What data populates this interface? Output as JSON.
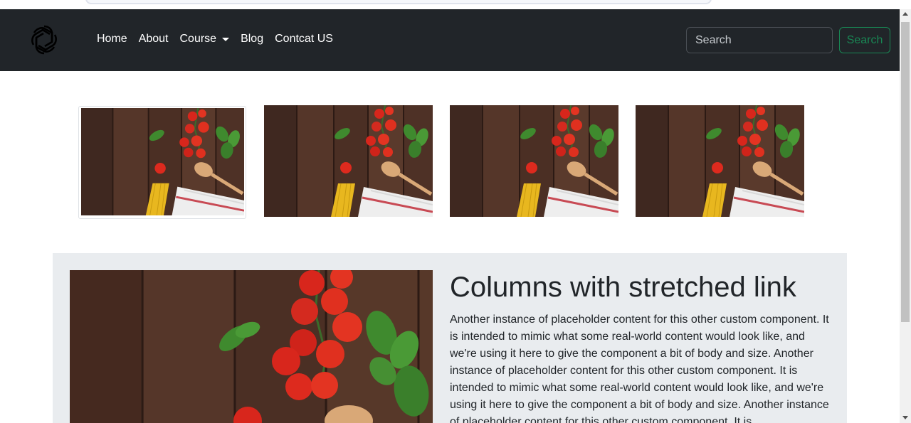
{
  "navbar": {
    "logo_icon": "openai-logo-icon",
    "links": [
      {
        "label": "Home"
      },
      {
        "label": "About"
      },
      {
        "label": "Course"
      },
      {
        "label": "Blog"
      },
      {
        "label": "Contcat US"
      }
    ],
    "search": {
      "placeholder": "Search",
      "button_label": "Search"
    },
    "colors": {
      "background": "#212529",
      "accent": "#198754"
    }
  },
  "gallery": {
    "image_icon": "food-photo-tomatoes-pasta"
  },
  "feature": {
    "title": "Columns with stretched link",
    "text": "Another instance of placeholder content for this other custom component. It is intended to mimic what some real-world content would look like, and we're using it here to give the component a bit of body and size. Another instance of placeholder content for this other custom component. It is intended to mimic what some real-world content would look like, and we're using it here to give the component a bit of body and size. Another instance of placeholder content for this other custom component. It is"
  }
}
